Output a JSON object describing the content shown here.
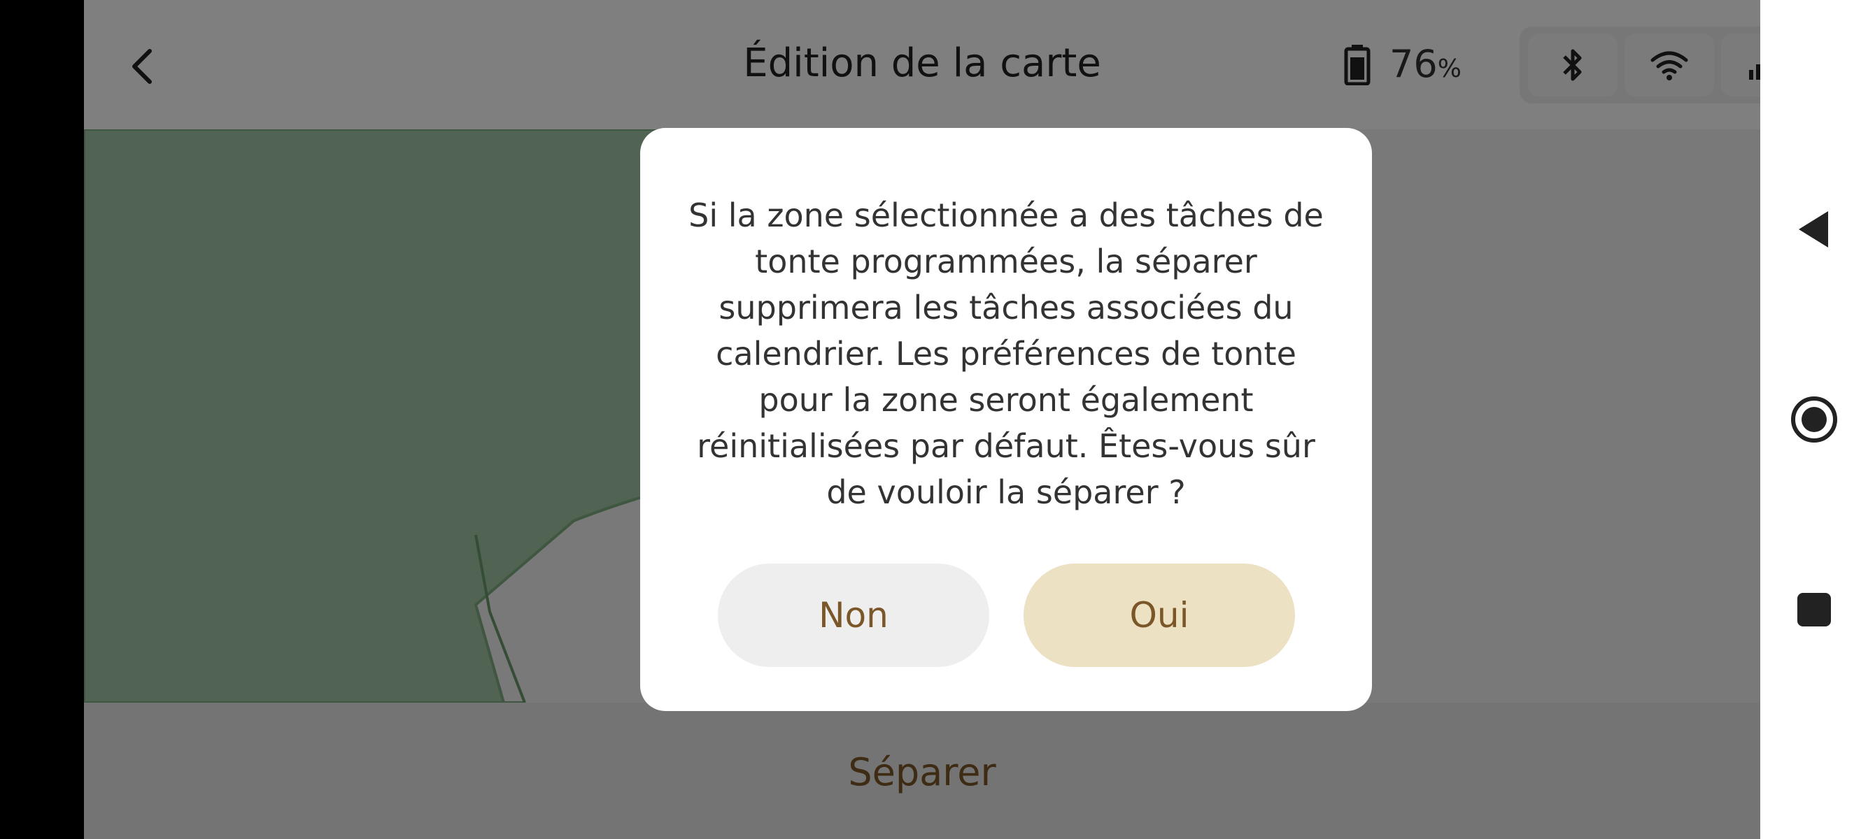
{
  "header": {
    "title": "Édition de la carte",
    "battery_value": "76",
    "battery_unit": "%"
  },
  "status": {
    "icons": [
      "bluetooth-icon",
      "wifi-icon",
      "cellular-signal-icon"
    ]
  },
  "dialog": {
    "message": "Si la zone sélectionnée a des tâches de tonte programmées, la séparer supprimera les tâches associées du calendrier. Les préférences de tonte pour la zone seront également réinitialisées par défaut. Êtes-vous sûr de vouloir la séparer ?",
    "no_label": "Non",
    "yes_label": "Oui"
  },
  "bottom": {
    "separate_label": "Séparer"
  },
  "colors": {
    "accent_text": "#7a5628",
    "map_zone": "#a3c7a5",
    "yes_button": "#ede1c4"
  }
}
